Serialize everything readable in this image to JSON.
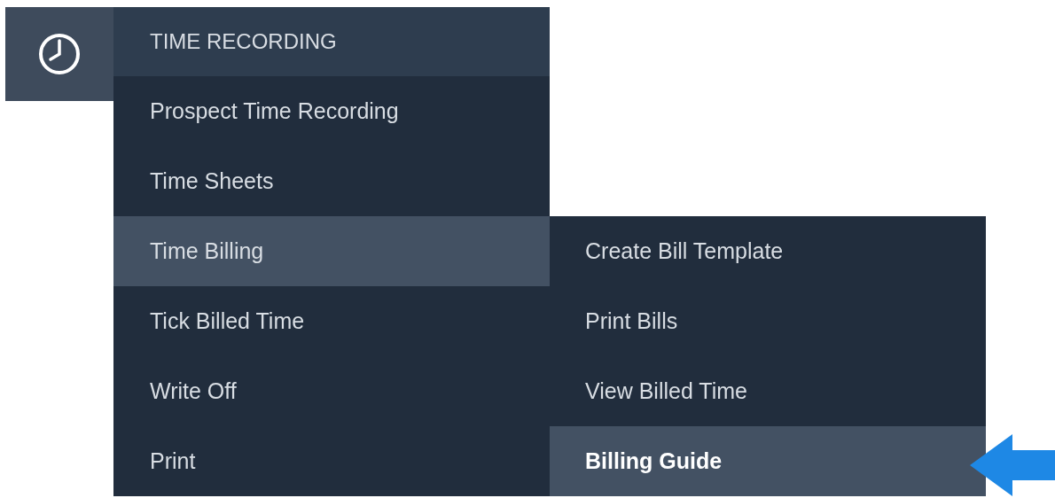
{
  "menu": {
    "title": "TIME RECORDING",
    "items": [
      {
        "label": "Prospect Time Recording",
        "selected": false
      },
      {
        "label": "Time Sheets",
        "selected": false
      },
      {
        "label": "Time Billing",
        "selected": true
      },
      {
        "label": "Tick Billed Time",
        "selected": false
      },
      {
        "label": "Write Off",
        "selected": false
      },
      {
        "label": "Print",
        "selected": false
      }
    ]
  },
  "submenu": {
    "items": [
      {
        "label": "Create Bill Template",
        "selected": false
      },
      {
        "label": "Print Bills",
        "selected": false
      },
      {
        "label": "View Billed Time",
        "selected": false
      },
      {
        "label": "Billing Guide",
        "selected": true
      }
    ]
  }
}
